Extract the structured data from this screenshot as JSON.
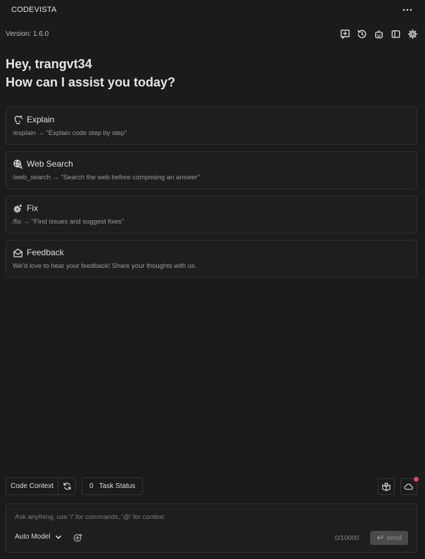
{
  "app": {
    "title": "CODEVISTA",
    "version": "Version: 1.6.0"
  },
  "header_actions": [
    {
      "icon": "new-chat-icon"
    },
    {
      "icon": "history-icon"
    },
    {
      "icon": "bot-icon"
    },
    {
      "icon": "sidebar-icon"
    },
    {
      "icon": "gear-icon"
    }
  ],
  "greeting": {
    "line1": "Hey, trangvt34",
    "line2": "How can I assist you today?"
  },
  "cards": [
    {
      "icon": "lightbulb-icon",
      "title": "Explain",
      "desc": "/explain → \"Explain code step by step\""
    },
    {
      "icon": "web-search-icon",
      "title": "Web Search",
      "desc": "/web_search → \"Search the web before composing an answer\""
    },
    {
      "icon": "fix-gear-icon",
      "title": "Fix",
      "desc": "/fix → \"Find issues and suggest fixes\""
    },
    {
      "icon": "mail-open-icon",
      "title": "Feedback",
      "desc": "We'd love to hear your feedback! Share your thoughts with us."
    }
  ],
  "context": {
    "code_context_label": "Code Context",
    "task_count": "0",
    "task_label": "Task Status"
  },
  "input": {
    "placeholder": "Ask anything, use '/' for commands, '@' for context",
    "model_label": "Auto Model",
    "char_count": "0/10000",
    "send_label": "send"
  },
  "colors": {
    "background": "#1b1b1b",
    "card_border": "#2f2f2f",
    "notification": "#e5484d",
    "send_disabled": "#4a4a4a"
  }
}
